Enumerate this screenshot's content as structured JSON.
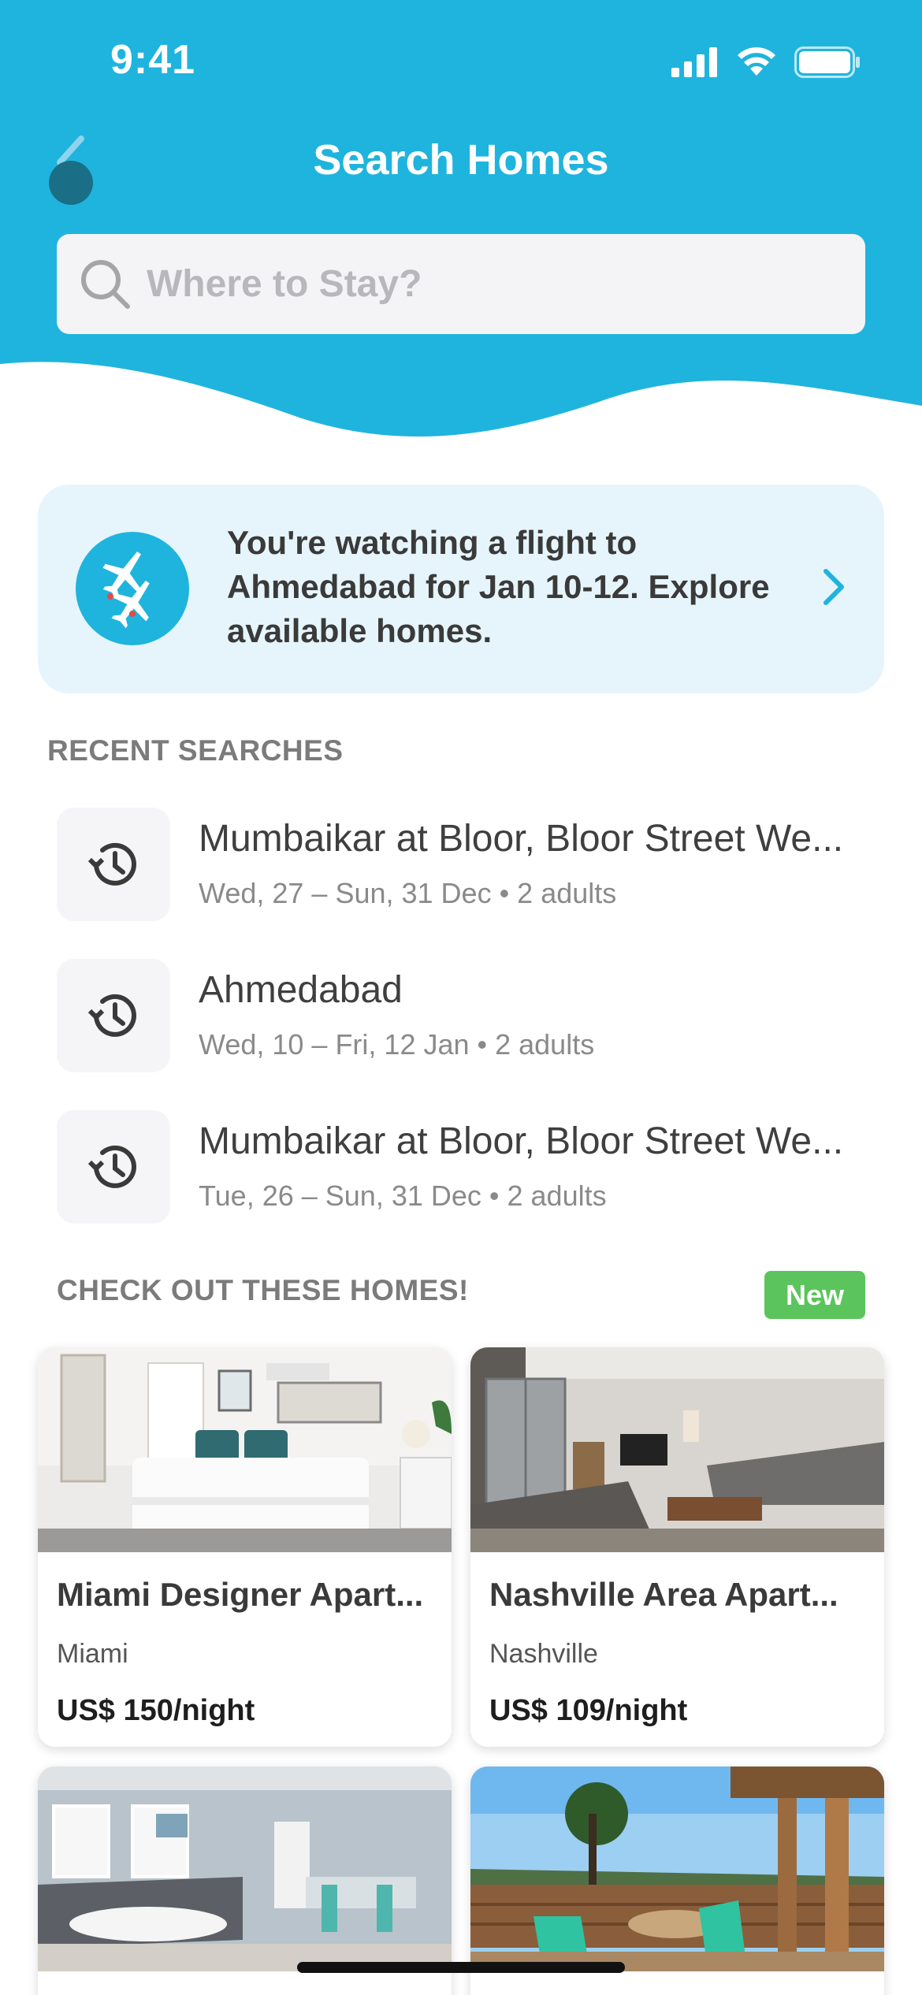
{
  "status_bar": {
    "time": "9:41"
  },
  "header": {
    "title": "Search Homes",
    "search_placeholder": "Where to Stay?",
    "accent_color": "#1fb4dd"
  },
  "promo": {
    "text": "You're watching a flight to Ahmedabad for Jan 10-12. Explore available homes.",
    "icon": "airplanes-icon"
  },
  "recent_searches": {
    "label": "RECENT SEARCHES",
    "items": [
      {
        "title": "Mumbaikar at Bloor, Bloor Street We...",
        "subtitle": "Wed, 27 – Sun, 31 Dec • 2 adults"
      },
      {
        "title": "Ahmedabad",
        "subtitle": "Wed, 10 – Fri, 12 Jan • 2 adults"
      },
      {
        "title": "Mumbaikar at Bloor, Bloor Street We...",
        "subtitle": "Tue, 26 – Sun, 31 Dec • 2 adults"
      }
    ]
  },
  "homes": {
    "label": "CHECK OUT THESE HOMES!",
    "badge": "New",
    "cards": [
      {
        "title": "Miami Designer Apart...",
        "location": "Miami",
        "price": "US$ 150/night"
      },
      {
        "title": "Nashville Area Apart...",
        "location": "Nashville",
        "price": "US$ 109/night"
      },
      {
        "title": "",
        "location": "",
        "price": ""
      },
      {
        "title": "",
        "location": "",
        "price": ""
      }
    ]
  }
}
